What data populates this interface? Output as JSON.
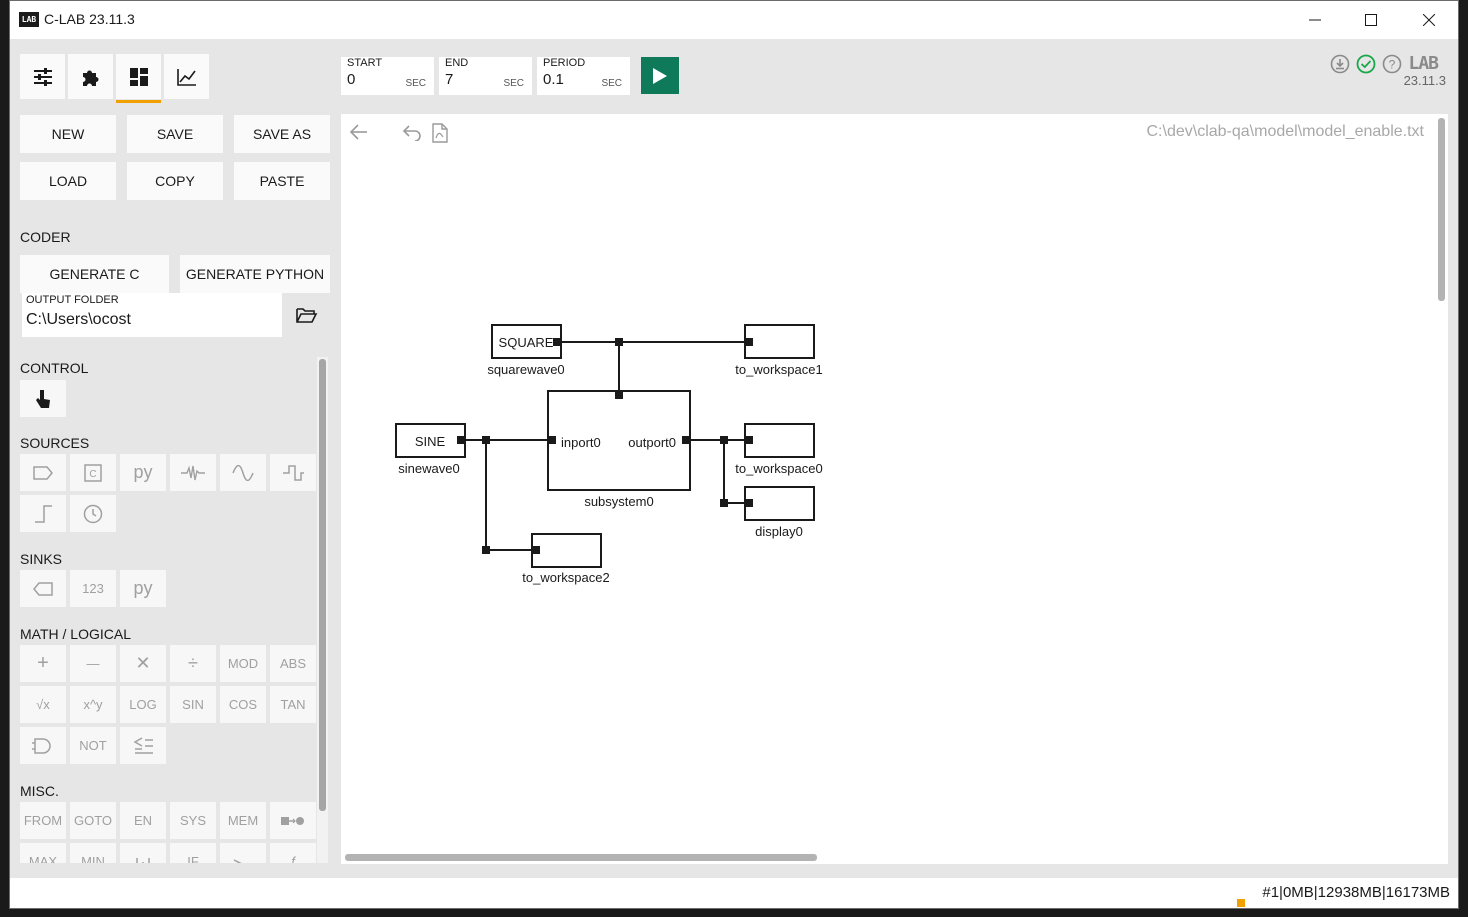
{
  "window": {
    "title": "C-LAB 23.11.3",
    "logo_text": "LAB"
  },
  "toolbar": {
    "tabs": [
      {
        "name": "settings",
        "icon": "sliders-icon"
      },
      {
        "name": "library",
        "icon": "puzzle-icon"
      },
      {
        "name": "model",
        "icon": "dashboard-icon",
        "active": true
      },
      {
        "name": "plot",
        "icon": "chart-line-icon"
      }
    ],
    "start": {
      "label": "START",
      "value": "0",
      "unit": "SEC"
    },
    "end": {
      "label": "END",
      "value": "7",
      "unit": "SEC"
    },
    "period": {
      "label": "PERIOD",
      "value": "0.1",
      "unit": "SEC"
    },
    "version": "23.11.3",
    "brand_logo": "LAB"
  },
  "file_buttons": {
    "new": "NEW",
    "save": "SAVE",
    "save_as": "SAVE AS",
    "load": "LOAD",
    "copy": "COPY",
    "paste": "PASTE"
  },
  "coder": {
    "label": "CODER",
    "generate_c": "GENERATE C",
    "generate_python": "GENERATE PYTHON",
    "output_folder_label": "OUTPUT FOLDER",
    "output_folder_value": "C:\\Users\\ocost"
  },
  "palette": {
    "control_label": "CONTROL",
    "sources_label": "SOURCES",
    "sinks_label": "SINKS",
    "math_label": "MATH / LOGICAL",
    "misc_label": "MISC.",
    "sources_row2": [],
    "sinks": [
      "",
      "123",
      "py"
    ],
    "sources": [
      "",
      "",
      "py"
    ],
    "math_row1": [
      "+",
      "—",
      "✕",
      "÷",
      "MOD",
      "ABS"
    ],
    "math_row2": [
      "√x",
      "x^y",
      "LOG",
      "SIN",
      "COS",
      "TAN"
    ],
    "math_row3": [
      "",
      "NOT",
      ""
    ],
    "misc_row1": [
      "FROM",
      "GOTO",
      "EN",
      "SYS",
      "MEM",
      ""
    ],
    "misc_row2": [
      "MAX",
      "MIN",
      "",
      "IF",
      "",
      "f"
    ]
  },
  "canvas": {
    "file_path": "C:\\dev\\clab-qa\\model\\model_enable.txt",
    "blocks": {
      "square": {
        "text": "SQUARE",
        "name": "squarewave0"
      },
      "sine": {
        "text": "SINE",
        "name": "sinewave0"
      },
      "subsystem": {
        "name": "subsystem0",
        "inport": "inport0",
        "outport": "outport0"
      },
      "ws1": {
        "name": "to_workspace1"
      },
      "ws0": {
        "name": "to_workspace0"
      },
      "display": {
        "name": "display0"
      },
      "ws2": {
        "name": "to_workspace2"
      }
    }
  },
  "statusbar": {
    "text": "#1|0MB|12938MB|16173MB"
  },
  "colors": {
    "run": "#0e7a5a",
    "accent": "#f0a100",
    "ok": "#1aa64a"
  }
}
